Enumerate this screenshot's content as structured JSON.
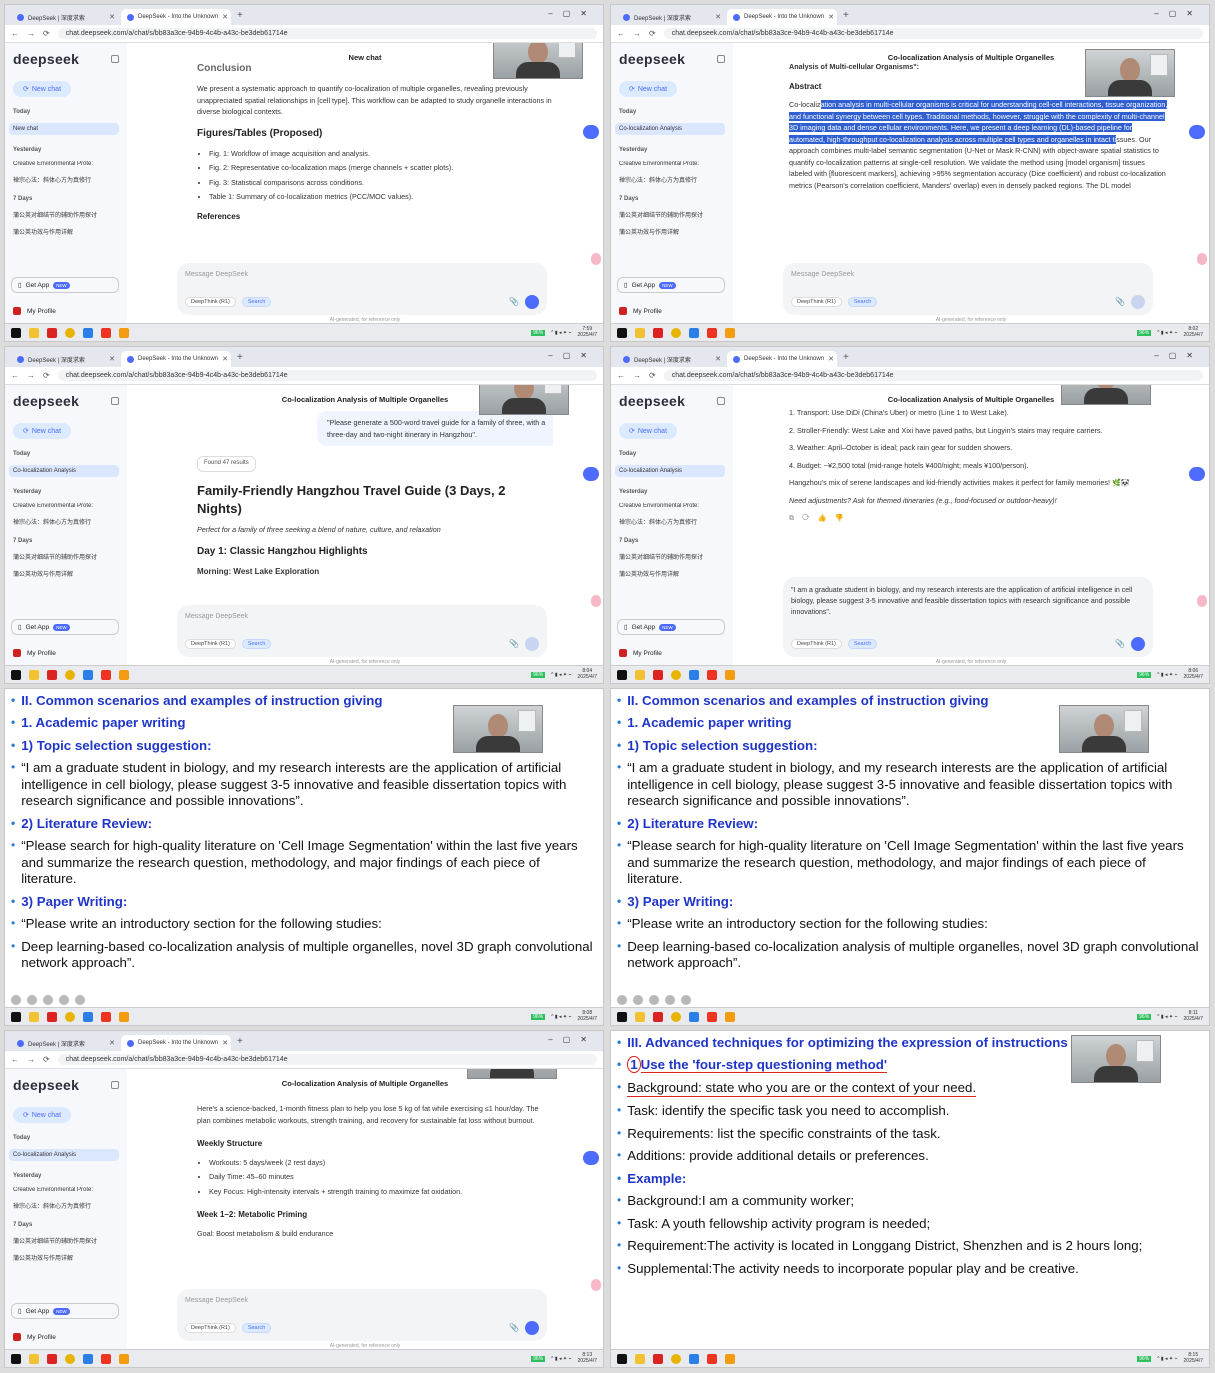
{
  "browser": {
    "tab1": "DeepSeek | 深度求索",
    "tab2": "DeepSeek - Into the Unknown",
    "url": "chat.deepseek.com/a/chat/s/bb83a3ce-94b9-4c4b-a43c-be3deb61714e"
  },
  "sidebar": {
    "logo": "deepseek",
    "new_chat": "New chat",
    "today": "Today",
    "yesterday": "Yesterday",
    "seven_days": "7 Days",
    "today_item_new": "New chat",
    "today_item_coloc": "Co-localization Analysis",
    "yest_item1": "Creative Environmental Prote:",
    "yest_item2": "禅宗心法：斜体心方为真修行",
    "week_item1": "蒲公英对细结节的辅助作用探讨",
    "week_item2": "蒲公英功效与作用详解",
    "get_app": "Get App",
    "new_badge": "NEW",
    "my_profile": "My Profile"
  },
  "composer": {
    "placeholder": "Message DeepSeek",
    "deepthink": "DeepThink (R1)",
    "search": "Search",
    "disclaimer": "AI-generated, for reference only"
  },
  "panel0": {
    "title": "New chat",
    "conclusion_h": "Conclusion",
    "conclusion_p": "We present a systematic approach to quantify co-localization of multiple organelles, revealing previously unappreciated spatial relationships in [cell type]. This workflow can be adapted to study organelle interactions in diverse biological contexts.",
    "figs_h": "Figures/Tables (Proposed)",
    "fig1": "Fig. 1: Workflow of image acquisition and analysis.",
    "fig2": "Fig. 2: Representative co-localization maps (merge channels + scatter plots).",
    "fig3": "Fig. 3: Statistical comparisons across conditions.",
    "table1": "Table 1: Summary of co-localization metrics (PCC/MOC values).",
    "refs_h": "References",
    "clock_time": "7:59",
    "clock_date": "2025/4/7"
  },
  "panel1": {
    "title": "Co-localization Analysis of Multiple Organelles",
    "intro": "Analysis of Multi-cellular Organisms\":",
    "abstract_h": "Abstract",
    "abs_a": "Co-localiz",
    "abs_hl": "ation analysis in multi-cellular organisms is critical for understanding cell-cell interactions, tissue organization, and functional synergy between cell types. Traditional methods, however, struggle with the complexity of multi-channel 3D imaging data and dense cellular environments. Here, we present a deep learning (DL)-based pipeline for automated, high-throughput co-localization analysis across multiple cell types and organelles in intact ti",
    "abs_b": "ssues. Our approach combines multi-label semantic segmentation (U-Net or Mask R-CNN) with object-aware spatial statistics to quantify co-localization patterns at single-cell resolution. We validate the method using [model organism] tissues labeled with [fluorescent markers], achieving >95% segmentation accuracy (Dice coefficient) and robust co-localization metrics (Pearson's correlation coefficient, Manders' overlap) even in densely packed regions. The DL model",
    "clock_time": "8:02",
    "clock_date": "2025/4/7"
  },
  "panel2": {
    "title": "Co-localization Analysis of Multiple Organelles",
    "prompt": "\"Please generate a 500-word travel guide for a family of three, with a three-day and two-night itinerary in Hangzhou\".",
    "found": "Found 47 results",
    "guide_h": "Family-Friendly Hangzhou Travel Guide (3 Days, 2 Nights)",
    "guide_sub": "Perfect for a family of three seeking a blend of nature, culture, and relaxation",
    "day1": "Day 1: Classic Hangzhou Highlights",
    "morning": "Morning: West Lake Exploration",
    "clock_time": "8:04",
    "clock_date": "2025/4/7"
  },
  "panel3": {
    "title": "Co-localization Analysis of Multiple Organelles",
    "tip1": "1. Transport: Use DiDi (China's Uber) or metro (Line 1 to West Lake).",
    "tip2": "2. Stroller-Friendly: West Lake and Xixi have paved paths, but Lingyin's stairs may require carriers.",
    "tip3": "3. Weather: April–October is ideal; pack rain gear for sudden showers.",
    "tip4": "4. Budget: ~¥2,500 total (mid-range hotels ¥400/night; meals ¥100/person).",
    "summary": "Hangzhou's mix of serene landscapes and kid-friendly activities makes it perfect for family memories! 🌿🐼",
    "adjust": "Need adjustments? Ask for themed itineraries (e.g., food-focused or outdoor-heavy)!",
    "draft": "\"I am a graduate student in biology, and my research interests are the application of artificial intelligence in cell biology, please suggest 3-5 innovative and feasible dissertation topics with research significance and possible innovations\".",
    "clock_time": "8:06",
    "clock_date": "2025/4/7"
  },
  "slide_a": {
    "l1": "II. Common scenarios and examples of instruction giving",
    "l2": "1. Academic paper writing",
    "l3": "1) Topic selection suggestion:",
    "l4": "“I am a graduate student in biology, and my research interests are the application of artificial intelligence in cell biology, please suggest 3-5 innovative and feasible dissertation topics with research significance and possible innovations”.",
    "l5": "2) Literature Review:",
    "l6": "“Please search for high-quality literature on 'Cell Image Segmentation' within the last five years and summarize the research question, methodology, and major findings of each piece of literature.",
    "l7": "3) Paper Writing:",
    "l8": "“Please write an introductory section for the following studies:",
    "l9": "Deep learning-based co-localization analysis of multiple organelles, novel 3D graph convolutional network approach”."
  },
  "panel4": {
    "clock_time": "8:08",
    "clock_date": "2025/4/7"
  },
  "panel5": {
    "clock_time": "8:11",
    "clock_date": "2025/4/7"
  },
  "panel6": {
    "title": "Co-localization Analysis of Multiple Organelles",
    "intro": "Here's a science-backed, 1-month fitness plan to help you lose 5 kg of fat while exercising ≤1 hour/day. The plan combines metabolic workouts, strength training, and recovery for sustainable fat loss without burnout.",
    "weekly_h": "Weekly Structure",
    "w1": "Workouts: 5 days/week (2 rest days)",
    "w2": "Daily Time: 45–60 minutes",
    "w3": "Key Focus: High-intensity intervals + strength training to maximize fat oxidation.",
    "week12": "Week 1–2: Metabolic Priming",
    "goal": "Goal: Boost metabolism & build endurance",
    "clock_time": "8:13",
    "clock_date": "2025/4/7"
  },
  "panel7": {
    "l1": "III. Advanced techniques for optimizing the expression of instructions",
    "l2a": "1",
    "l2b": "Use the 'four-step questioning method'",
    "l3": "Background: state who you are or the context of your need.",
    "l4": "Task: identify the specific task you need to accomplish.",
    "l5": "Requirements: list the specific constraints of the task.",
    "l6": "Additions: provide additional details or preferences.",
    "l7": "Example:",
    "l8": "Background:I am a community worker;",
    "l9": "Task: A youth fellowship activity program is needed;",
    "l10": "Requirement:The activity is located in Longgang District, Shenzhen and is 2 hours long;",
    "l11": "Supplemental:The activity needs to incorporate popular play and be creative.",
    "clock_time": "8:15",
    "clock_date": "2025/4/7"
  },
  "colors": {
    "accent": "#4d6bfe",
    "slide_heading": "#1f35c8",
    "highlight": "#2f5fd0",
    "annotation": "#dd2222"
  }
}
